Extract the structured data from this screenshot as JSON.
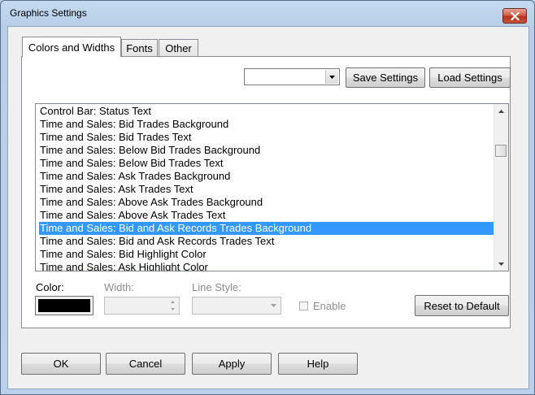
{
  "window": {
    "title": "Graphics Settings"
  },
  "tabs": [
    {
      "label": "Colors and Widths",
      "active": true
    },
    {
      "label": "Fonts",
      "active": false
    },
    {
      "label": "Other",
      "active": false
    }
  ],
  "settings_bar": {
    "preset_value": "",
    "save_label": "Save Settings",
    "load_label": "Load Settings"
  },
  "list": {
    "items": [
      "Control Bar: Status Text",
      "Time and Sales: Bid Trades Background",
      "Time and Sales: Bid Trades Text",
      "Time and Sales: Below Bid Trades Background",
      "Time and Sales: Below Bid Trades Text",
      "Time and Sales: Ask Trades Background",
      "Time and Sales: Ask Trades Text",
      "Time and Sales: Above Ask Trades Background",
      "Time and Sales: Above Ask Trades Text",
      "Time and Sales: Bid and Ask Records Trades Background",
      "Time and Sales: Bid and Ask Records Trades Text",
      "Time and Sales: Bid Highlight Color",
      "Time and Sales: Ask Highlight Color"
    ],
    "selected_index": 9
  },
  "properties": {
    "color_label": "Color:",
    "color_value": "#000000",
    "width_label": "Width:",
    "width_value": "",
    "line_style_label": "Line Style:",
    "line_style_value": "",
    "enable_label": "Enable",
    "enable_checked": false,
    "reset_label": "Reset to Default"
  },
  "footer": {
    "ok_label": "OK",
    "cancel_label": "Cancel",
    "apply_label": "Apply",
    "help_label": "Help"
  },
  "colors": {
    "selection": "#3399ff",
    "title_bar": "#b9d1ea",
    "close_button": "#c9503a"
  }
}
